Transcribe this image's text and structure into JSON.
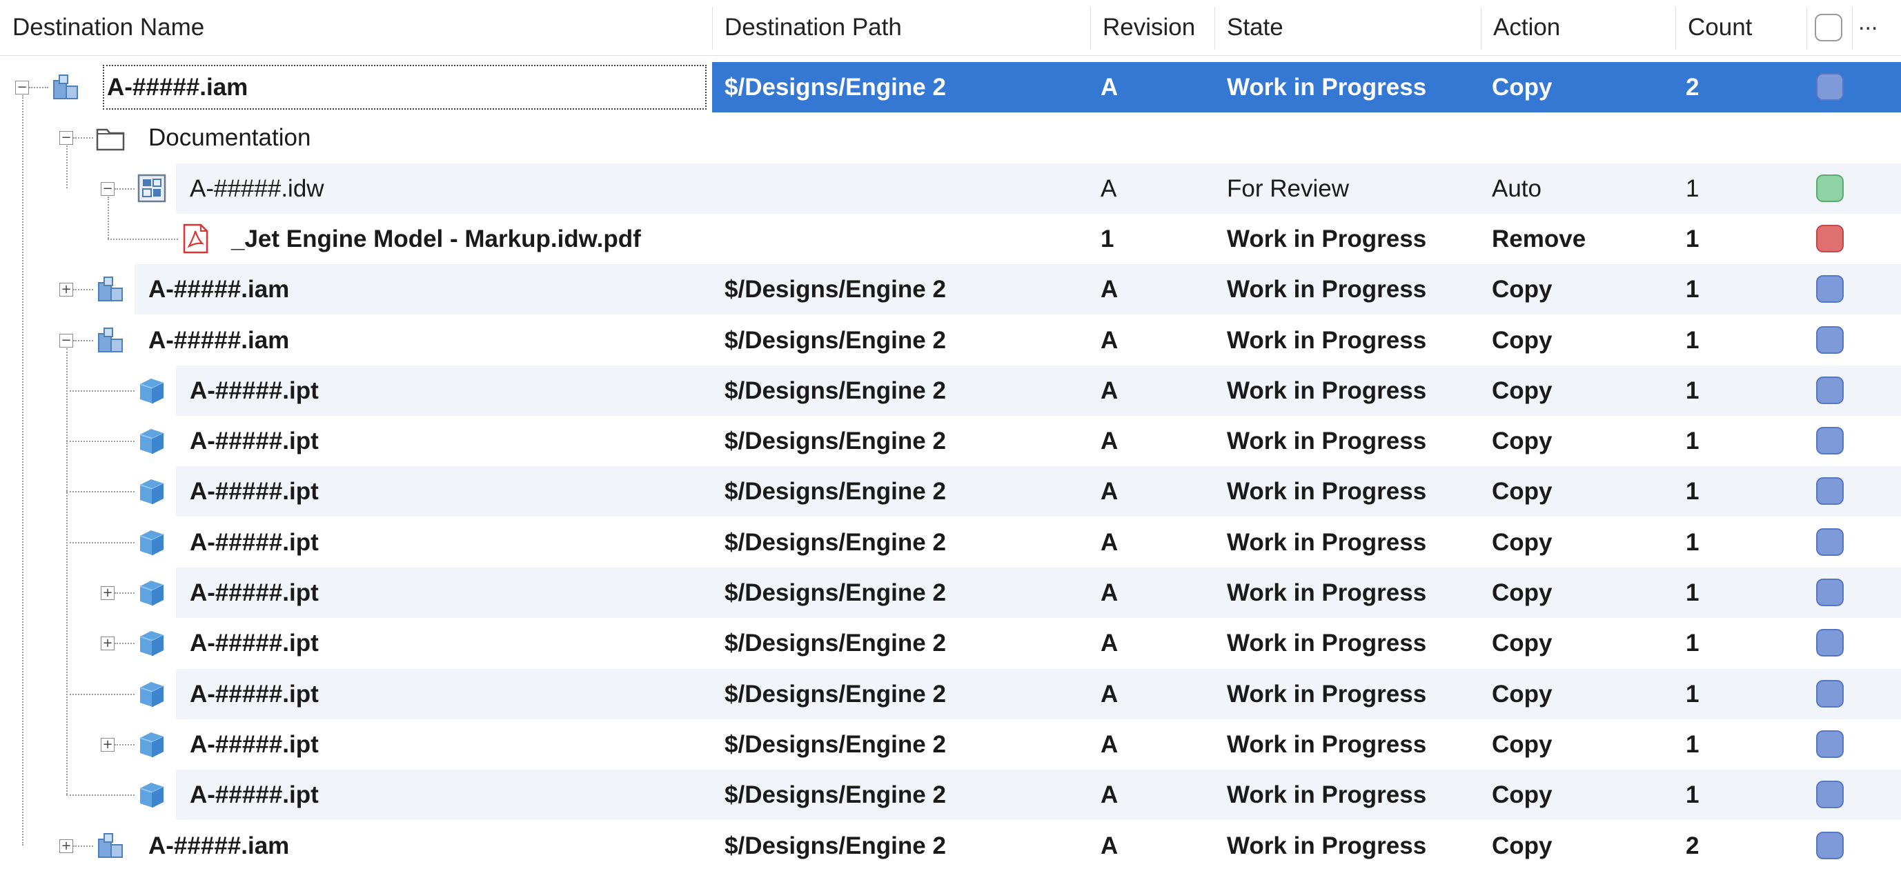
{
  "columns": {
    "name": "Destination Name",
    "path": "Destination Path",
    "revision": "Revision",
    "state": "State",
    "action": "Action",
    "count": "Count",
    "more": "..."
  },
  "rows": [
    {
      "name": "A-#####.iam",
      "path": "$/Designs/Engine 2",
      "revision": "A",
      "state": "Work in Progress",
      "action": "Copy",
      "count": "2",
      "level": 0,
      "icon": "assembly-icon",
      "expander": "minus",
      "bold": true,
      "selected": true,
      "status": "blue"
    },
    {
      "name": "Documentation",
      "path": "",
      "revision": "",
      "state": "",
      "action": "",
      "count": "",
      "level": 1,
      "icon": "folder-icon",
      "expander": "minus",
      "bold": false,
      "status": "none"
    },
    {
      "name": "A-#####.idw",
      "path": "",
      "revision": "A",
      "state": "For Review",
      "action": "Auto",
      "count": "1",
      "level": 2,
      "icon": "drawing-icon",
      "expander": "minus",
      "bold": false,
      "status": "green"
    },
    {
      "name": "_Jet Engine Model - Markup.idw.pdf",
      "path": "",
      "revision": "1",
      "state": "Work in Progress",
      "action": "Remove",
      "count": "1",
      "level": 3,
      "icon": "pdf-icon",
      "expander": "none",
      "bold": true,
      "status": "red"
    },
    {
      "name": "A-#####.iam",
      "path": "$/Designs/Engine 2",
      "revision": "A",
      "state": "Work in Progress",
      "action": "Copy",
      "count": "1",
      "level": 1,
      "icon": "assembly-icon",
      "expander": "plus",
      "bold": true,
      "status": "blue"
    },
    {
      "name": "A-#####.iam",
      "path": "$/Designs/Engine 2",
      "revision": "A",
      "state": "Work in Progress",
      "action": "Copy",
      "count": "1",
      "level": 1,
      "icon": "assembly-icon",
      "expander": "minus",
      "bold": true,
      "status": "blue"
    },
    {
      "name": "A-#####.ipt",
      "path": "$/Designs/Engine 2",
      "revision": "A",
      "state": "Work in Progress",
      "action": "Copy",
      "count": "1",
      "level": 2,
      "icon": "part-icon",
      "expander": "none",
      "bold": true,
      "status": "blue"
    },
    {
      "name": "A-#####.ipt",
      "path": "$/Designs/Engine 2",
      "revision": "A",
      "state": "Work in Progress",
      "action": "Copy",
      "count": "1",
      "level": 2,
      "icon": "part-icon",
      "expander": "none",
      "bold": true,
      "status": "blue"
    },
    {
      "name": "A-#####.ipt",
      "path": "$/Designs/Engine 2",
      "revision": "A",
      "state": "Work in Progress",
      "action": "Copy",
      "count": "1",
      "level": 2,
      "icon": "part-icon",
      "expander": "none",
      "bold": true,
      "status": "blue"
    },
    {
      "name": "A-#####.ipt",
      "path": "$/Designs/Engine 2",
      "revision": "A",
      "state": "Work in Progress",
      "action": "Copy",
      "count": "1",
      "level": 2,
      "icon": "part-icon",
      "expander": "none",
      "bold": true,
      "status": "blue"
    },
    {
      "name": "A-#####.ipt",
      "path": "$/Designs/Engine 2",
      "revision": "A",
      "state": "Work in Progress",
      "action": "Copy",
      "count": "1",
      "level": 2,
      "icon": "part-icon",
      "expander": "plus",
      "bold": true,
      "status": "blue"
    },
    {
      "name": "A-#####.ipt",
      "path": "$/Designs/Engine 2",
      "revision": "A",
      "state": "Work in Progress",
      "action": "Copy",
      "count": "1",
      "level": 2,
      "icon": "part-icon",
      "expander": "plus",
      "bold": true,
      "status": "blue"
    },
    {
      "name": "A-#####.ipt",
      "path": "$/Designs/Engine 2",
      "revision": "A",
      "state": "Work in Progress",
      "action": "Copy",
      "count": "1",
      "level": 2,
      "icon": "part-icon",
      "expander": "none",
      "bold": true,
      "status": "blue"
    },
    {
      "name": "A-#####.ipt",
      "path": "$/Designs/Engine 2",
      "revision": "A",
      "state": "Work in Progress",
      "action": "Copy",
      "count": "1",
      "level": 2,
      "icon": "part-icon",
      "expander": "plus",
      "bold": true,
      "status": "blue"
    },
    {
      "name": "A-#####.ipt",
      "path": "$/Designs/Engine 2",
      "revision": "A",
      "state": "Work in Progress",
      "action": "Copy",
      "count": "1",
      "level": 2,
      "icon": "part-icon",
      "expander": "none",
      "bold": true,
      "status": "blue"
    },
    {
      "name": "A-#####.iam",
      "path": "$/Designs/Engine 2",
      "revision": "A",
      "state": "Work in Progress",
      "action": "Copy",
      "count": "2",
      "level": 1,
      "icon": "assembly-icon",
      "expander": "plus",
      "bold": true,
      "status": "blue"
    }
  ],
  "colors": {
    "selection": "#3478d4",
    "row_shade": "#f1f4f8",
    "status_blue": "#7f9ad8",
    "status_green": "#8fd3a5",
    "status_red": "#e07070"
  }
}
